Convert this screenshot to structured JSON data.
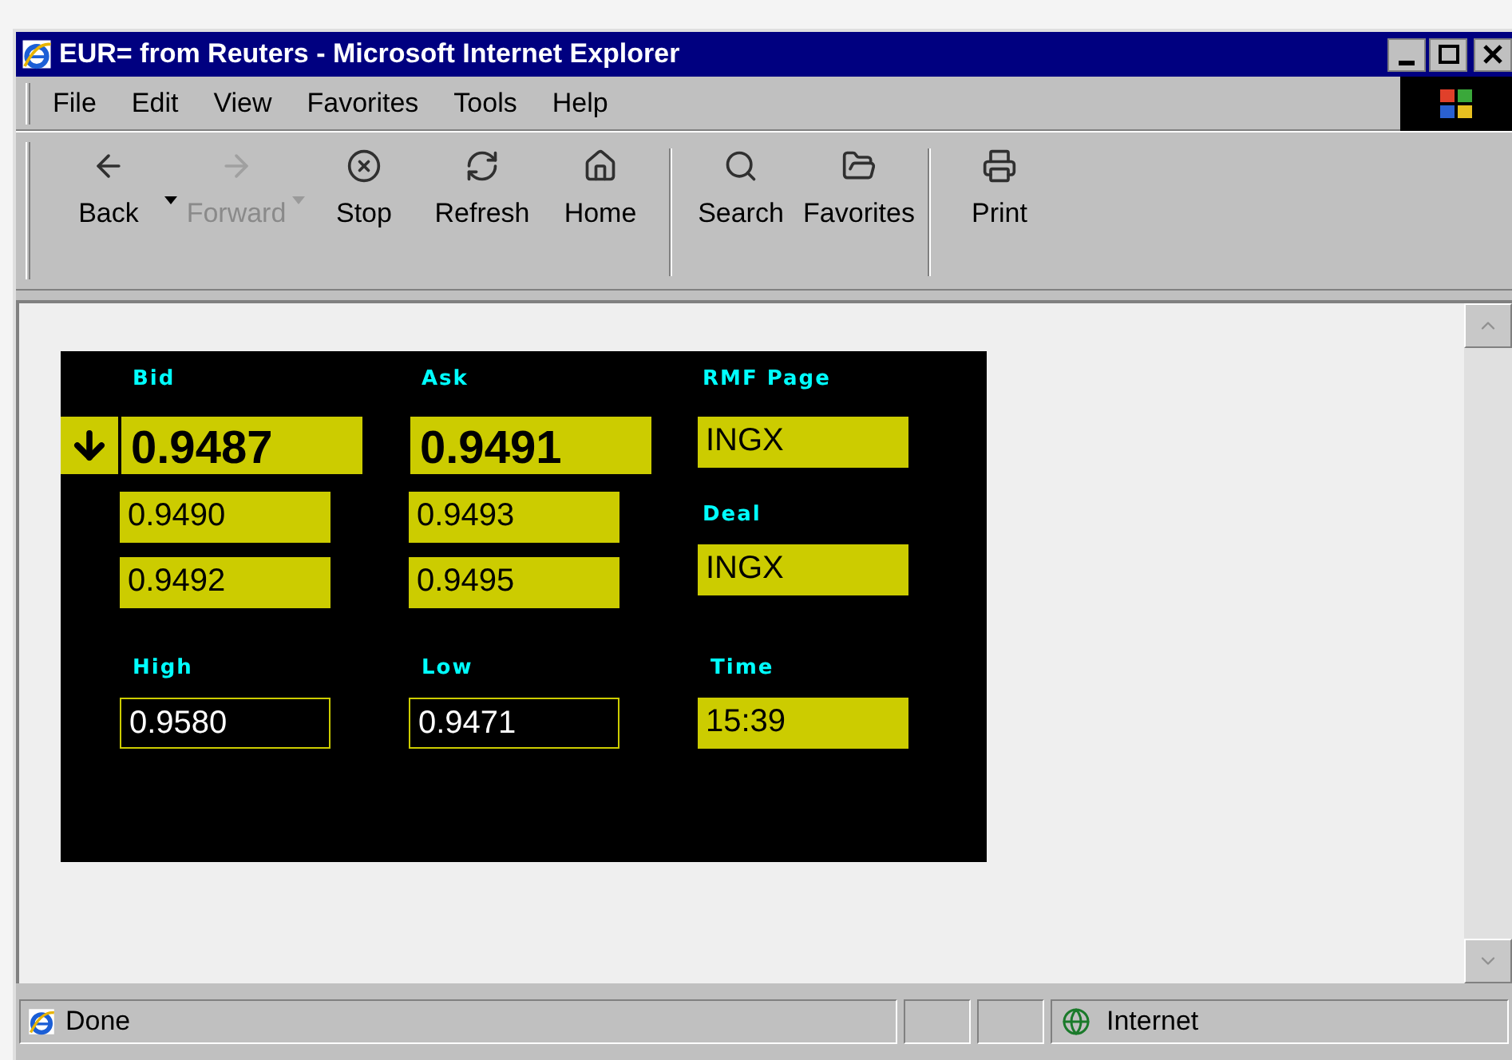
{
  "window": {
    "title": "EUR= from Reuters - Microsoft Internet Explorer"
  },
  "menu": [
    "File",
    "Edit",
    "View",
    "Favorites",
    "Tools",
    "Help"
  ],
  "toolbar": [
    {
      "label": "Back",
      "kind": "back",
      "disabled": false,
      "dropdown": true
    },
    {
      "label": "Forward",
      "kind": "forward",
      "disabled": true,
      "dropdown": true
    },
    {
      "label": "Stop",
      "kind": "stop",
      "disabled": false,
      "dropdown": false
    },
    {
      "label": "Refresh",
      "kind": "refresh",
      "disabled": false,
      "dropdown": false
    },
    {
      "label": "Home",
      "kind": "home",
      "disabled": false,
      "dropdown": false
    },
    {
      "label": "Search",
      "kind": "search",
      "disabled": false,
      "dropdown": false
    },
    {
      "label": "Favorites",
      "kind": "favorites",
      "disabled": false,
      "dropdown": false
    },
    {
      "label": "Print",
      "kind": "print",
      "disabled": false,
      "dropdown": false
    }
  ],
  "quote_panel": {
    "falling": true,
    "bid": {
      "label": "Bid",
      "best": "0.9487",
      "depth": [
        "0.9490",
        "0.9492"
      ]
    },
    "ask": {
      "label": "Ask",
      "best": "0.9491",
      "depth": [
        "0.9493",
        "0.9495"
      ]
    },
    "rmf_page": {
      "label": "RMF Page",
      "value": "INGX",
      "kind": "filled"
    },
    "deal": {
      "label": "Deal",
      "value": "INGX",
      "kind": "filled"
    },
    "high": {
      "label": "High",
      "value": "0.9580",
      "kind": "outline"
    },
    "low": {
      "label": "Low",
      "value": "0.9471",
      "kind": "outline"
    },
    "time": {
      "label": "Time",
      "value": "15:39",
      "kind": "filled"
    }
  },
  "status_bar": {
    "text": "Done",
    "zone": "Internet"
  }
}
